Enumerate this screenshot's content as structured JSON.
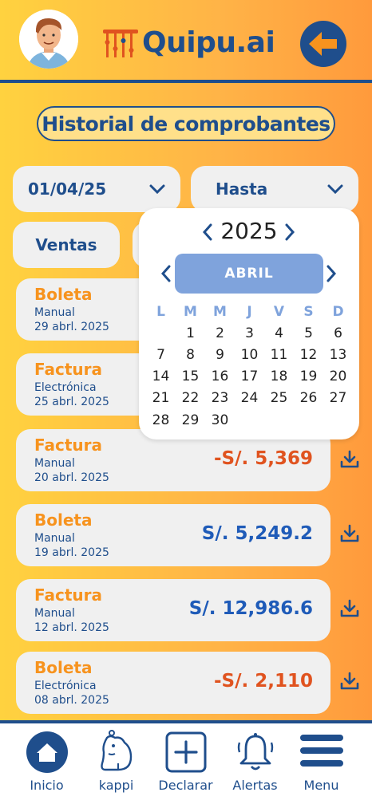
{
  "app": {
    "logo_text": "Quipu.ai"
  },
  "header": {
    "title": "Historial de comprobantes"
  },
  "filters": {
    "from_date": "01/04/25",
    "to_date": "Hasta",
    "tabs": [
      {
        "label": "Ventas"
      }
    ]
  },
  "calendar": {
    "year": "2025",
    "month": "ABRIL",
    "weekdays": [
      "L",
      "M",
      "M",
      "J",
      "V",
      "S",
      "D"
    ],
    "weeks": [
      [
        "",
        "1",
        "2",
        "3",
        "4",
        "5",
        "6"
      ],
      [
        "7",
        "8",
        "9",
        "10",
        "11",
        "12",
        "13"
      ],
      [
        "14",
        "15",
        "16",
        "17",
        "18",
        "19",
        "20"
      ],
      [
        "21",
        "22",
        "23",
        "24",
        "25",
        "26",
        "27"
      ],
      [
        "28",
        "29",
        "30",
        "",
        "",
        "",
        ""
      ]
    ]
  },
  "receipts": [
    {
      "type": "Boleta",
      "source": "Manual",
      "date": "29 abrl. 2025",
      "amount": "",
      "color": ""
    },
    {
      "type": "Factura",
      "source": "Electrónica",
      "date": "25 abrl. 2025",
      "amount": "",
      "color": ""
    },
    {
      "type": "Factura",
      "source": "Manual",
      "date": "20 abrl. 2025",
      "amount": "-S/. 5,369",
      "color": "#e0531f"
    },
    {
      "type": "Boleta",
      "source": "Manual",
      "date": "19 abrl. 2025",
      "amount": "S/. 5,249.2",
      "color": "#1f5bb8"
    },
    {
      "type": "Factura",
      "source": "Manual",
      "date": "12 abrl. 2025",
      "amount": "S/. 12,986.6",
      "color": "#1f5bb8"
    },
    {
      "type": "Boleta",
      "source": "Electrónica",
      "date": "08 abrl. 2025",
      "amount": "-S/. 2,110",
      "color": "#e0531f"
    }
  ],
  "nav": [
    {
      "label": "Inicio",
      "icon": "home-icon"
    },
    {
      "label": "kappi",
      "icon": "capybara-icon"
    },
    {
      "label": "Declarar",
      "icon": "plus-square-icon"
    },
    {
      "label": "Alertas",
      "icon": "bell-icon"
    },
    {
      "label": "Menu",
      "icon": "hamburger-icon"
    }
  ],
  "colors": {
    "primary": "#1f4e8c",
    "accent": "#f7931e",
    "negative": "#e0531f",
    "positive": "#1f5bb8",
    "calendar_accent": "#7fa3dc"
  }
}
